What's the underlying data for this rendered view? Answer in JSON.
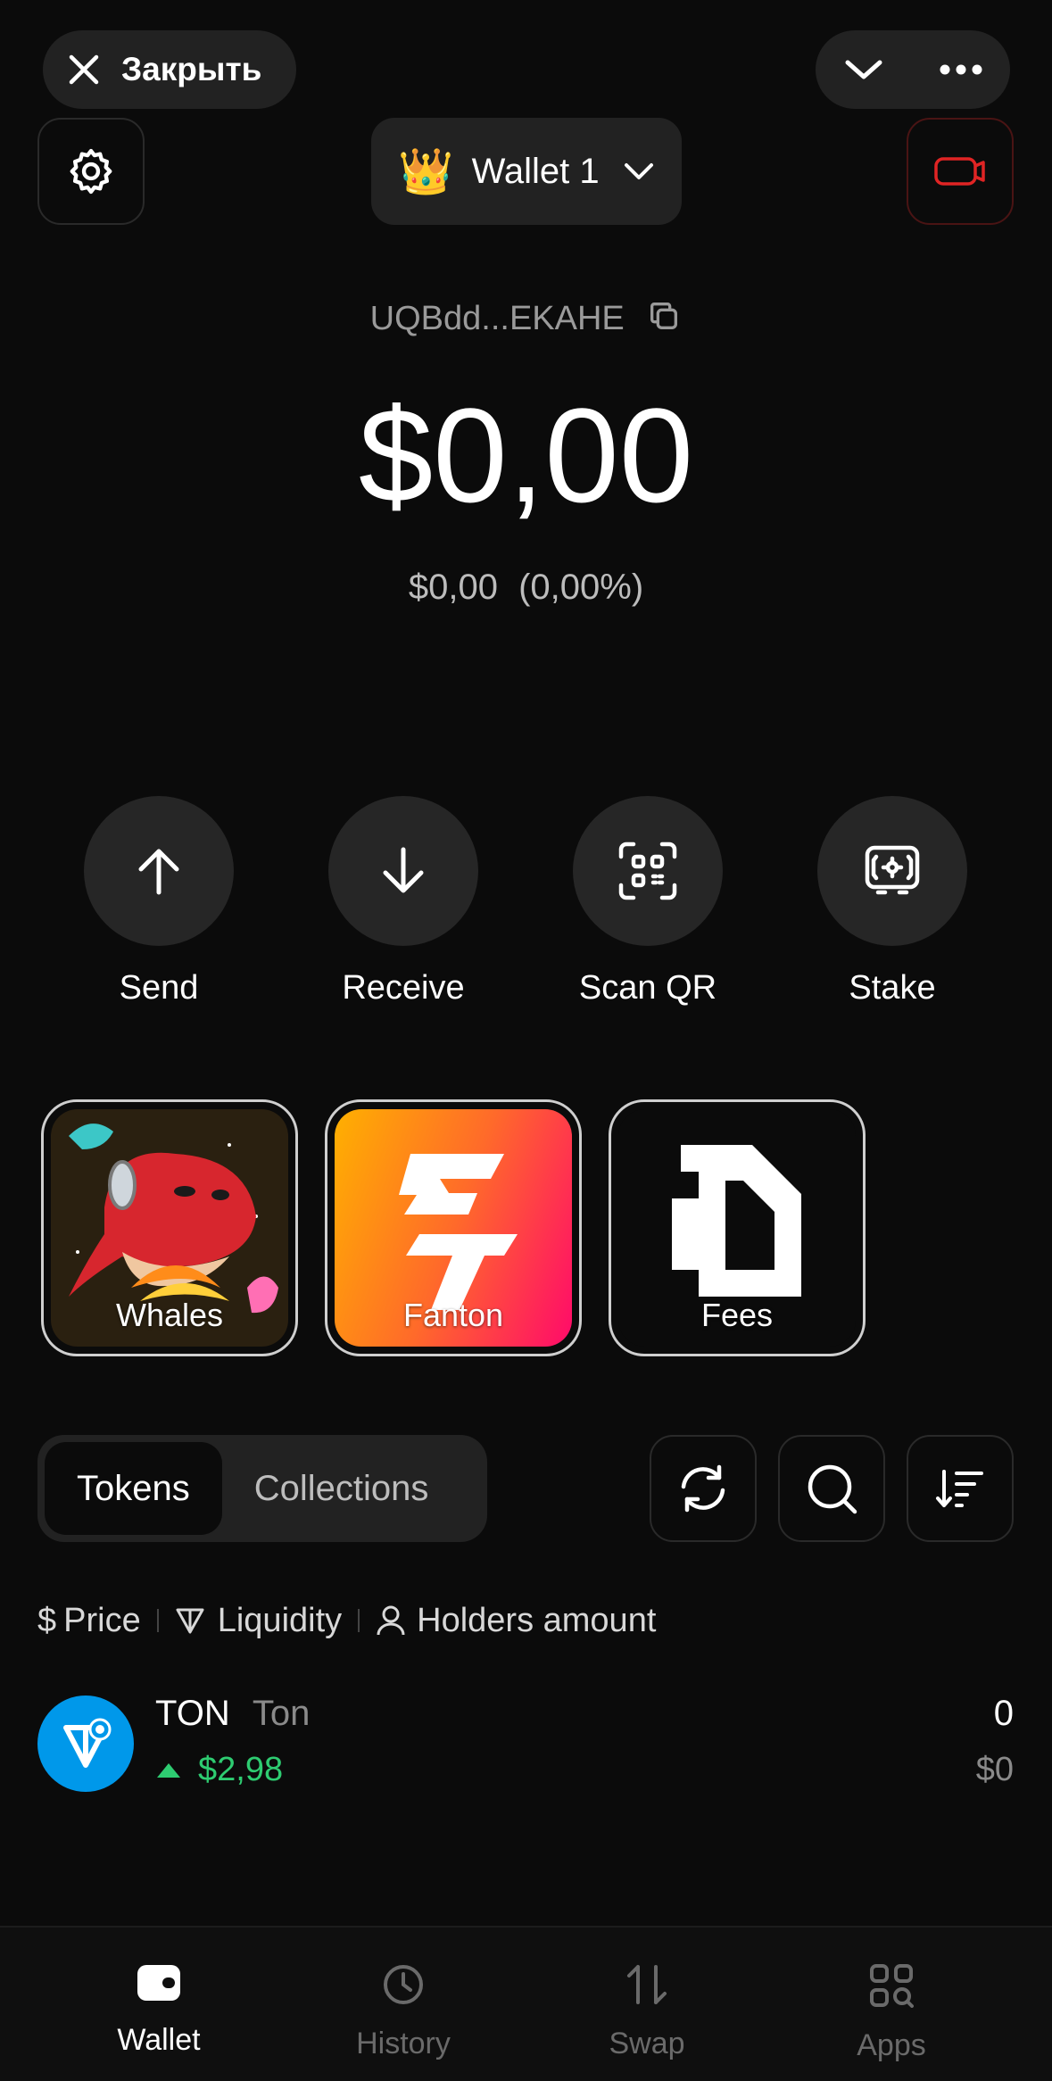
{
  "header": {
    "close_label": "Закрыть",
    "wallet_emoji": "👑",
    "wallet_name": "Wallet 1"
  },
  "balance": {
    "address": "UQBdd...EKAHE",
    "amount": "$0,00",
    "change_value": "$0,00",
    "change_percent": "(0,00%)"
  },
  "actions": [
    {
      "label": "Send",
      "icon": "arrow-up-icon"
    },
    {
      "label": "Receive",
      "icon": "arrow-down-icon"
    },
    {
      "label": "Scan QR",
      "icon": "qr-scan-icon"
    },
    {
      "label": "Stake",
      "icon": "stake-icon"
    }
  ],
  "apps": [
    {
      "label": "Whales"
    },
    {
      "label": "Fanton"
    },
    {
      "label": "Fees"
    }
  ],
  "tabs": {
    "tokens": "Tokens",
    "collections": "Collections"
  },
  "filters": {
    "price": "Price",
    "liquidity": "Liquidity",
    "holders": "Holders amount"
  },
  "tokens": [
    {
      "symbol": "TON",
      "name": "Ton",
      "price": "$2,98",
      "amount": "0",
      "value": "$0"
    }
  ],
  "nav": [
    {
      "label": "Wallet"
    },
    {
      "label": "History"
    },
    {
      "label": "Swap"
    },
    {
      "label": "Apps"
    }
  ],
  "colors": {
    "background": "#0b0b0b",
    "accent_green": "#2ecc71",
    "record_red": "#e02424",
    "ton_blue": "#0098ea"
  }
}
